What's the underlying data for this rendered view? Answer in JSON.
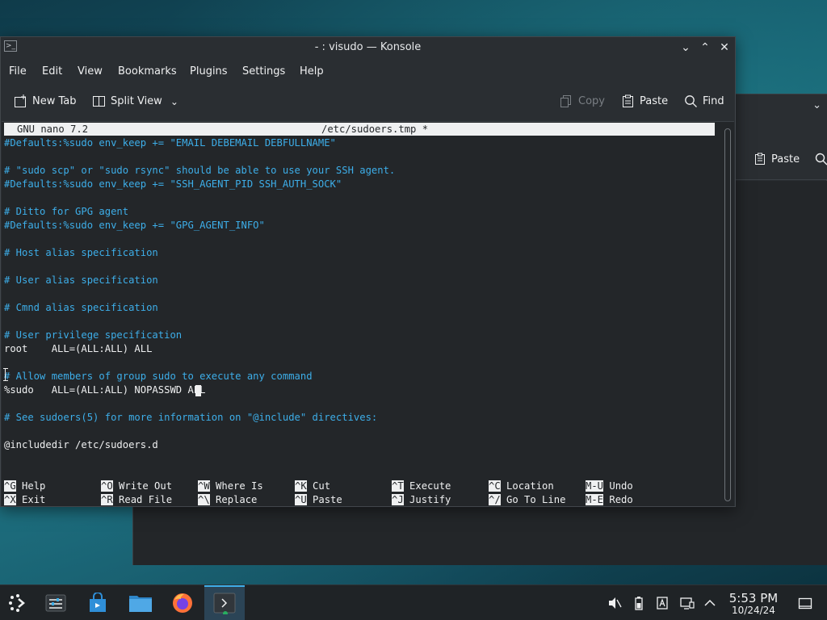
{
  "window": {
    "title": "- : visudo — Konsole"
  },
  "menubar": [
    "File",
    "Edit",
    "View",
    "Bookmarks",
    "Plugins",
    "Settings",
    "Help"
  ],
  "toolbar": {
    "new_tab": "New Tab",
    "split_view": "Split View",
    "copy": "Copy",
    "paste": "Paste",
    "find": "Find"
  },
  "background_window": {
    "paste": "Paste"
  },
  "nano": {
    "version": "GNU nano 7.2",
    "filename": "/etc/sudoers.tmp *",
    "lines": [
      "#Defaults:%sudo env_keep += \"EMAIL DEBEMAIL DEBFULLNAME\"",
      "",
      "# \"sudo scp\" or \"sudo rsync\" should be able to use your SSH agent.",
      "#Defaults:%sudo env_keep += \"SSH_AGENT_PID SSH_AUTH_SOCK\"",
      "",
      "# Ditto for GPG agent",
      "#Defaults:%sudo env_keep += \"GPG_AGENT_INFO\"",
      "",
      "# Host alias specification",
      "",
      "# User alias specification",
      "",
      "# Cmnd alias specification",
      "",
      "# User privilege specification",
      "root    ALL=(ALL:ALL) ALL",
      "",
      "# Allow members of group sudo to execute any command",
      "%sudo   ALL=(ALL:ALL) NOPASSWD ALL",
      "",
      "# See sudoers(5) for more information on \"@include\" directives:",
      "",
      "@includedir /etc/sudoers.d"
    ],
    "shortcuts": [
      {
        "key": "^G",
        "label": "Help"
      },
      {
        "key": "^X",
        "label": "Exit"
      },
      {
        "key": "^O",
        "label": "Write Out"
      },
      {
        "key": "^R",
        "label": "Read File"
      },
      {
        "key": "^W",
        "label": "Where Is"
      },
      {
        "key": "^\\",
        "label": "Replace"
      },
      {
        "key": "^K",
        "label": "Cut"
      },
      {
        "key": "^U",
        "label": "Paste"
      },
      {
        "key": "^T",
        "label": "Execute"
      },
      {
        "key": "^J",
        "label": "Justify"
      },
      {
        "key": "^C",
        "label": "Location"
      },
      {
        "key": "^/",
        "label": "Go To Line"
      },
      {
        "key": "M-U",
        "label": "Undo"
      },
      {
        "key": "M-E",
        "label": "Redo"
      }
    ]
  },
  "taskbar": {
    "apps": [
      "app-launcher-icon",
      "system-settings-icon",
      "discover-store-icon",
      "file-manager-icon",
      "firefox-icon",
      "konsole-icon"
    ],
    "tray": [
      "volume-muted-icon",
      "battery-icon",
      "clipboard-icon",
      "network-icon",
      "expand-tray-icon"
    ],
    "time": "5:53 PM",
    "date": "10/24/24"
  },
  "colors": {
    "accent": "#3daee9",
    "terminal_bg": "#232629",
    "text": "#eff0f1"
  }
}
